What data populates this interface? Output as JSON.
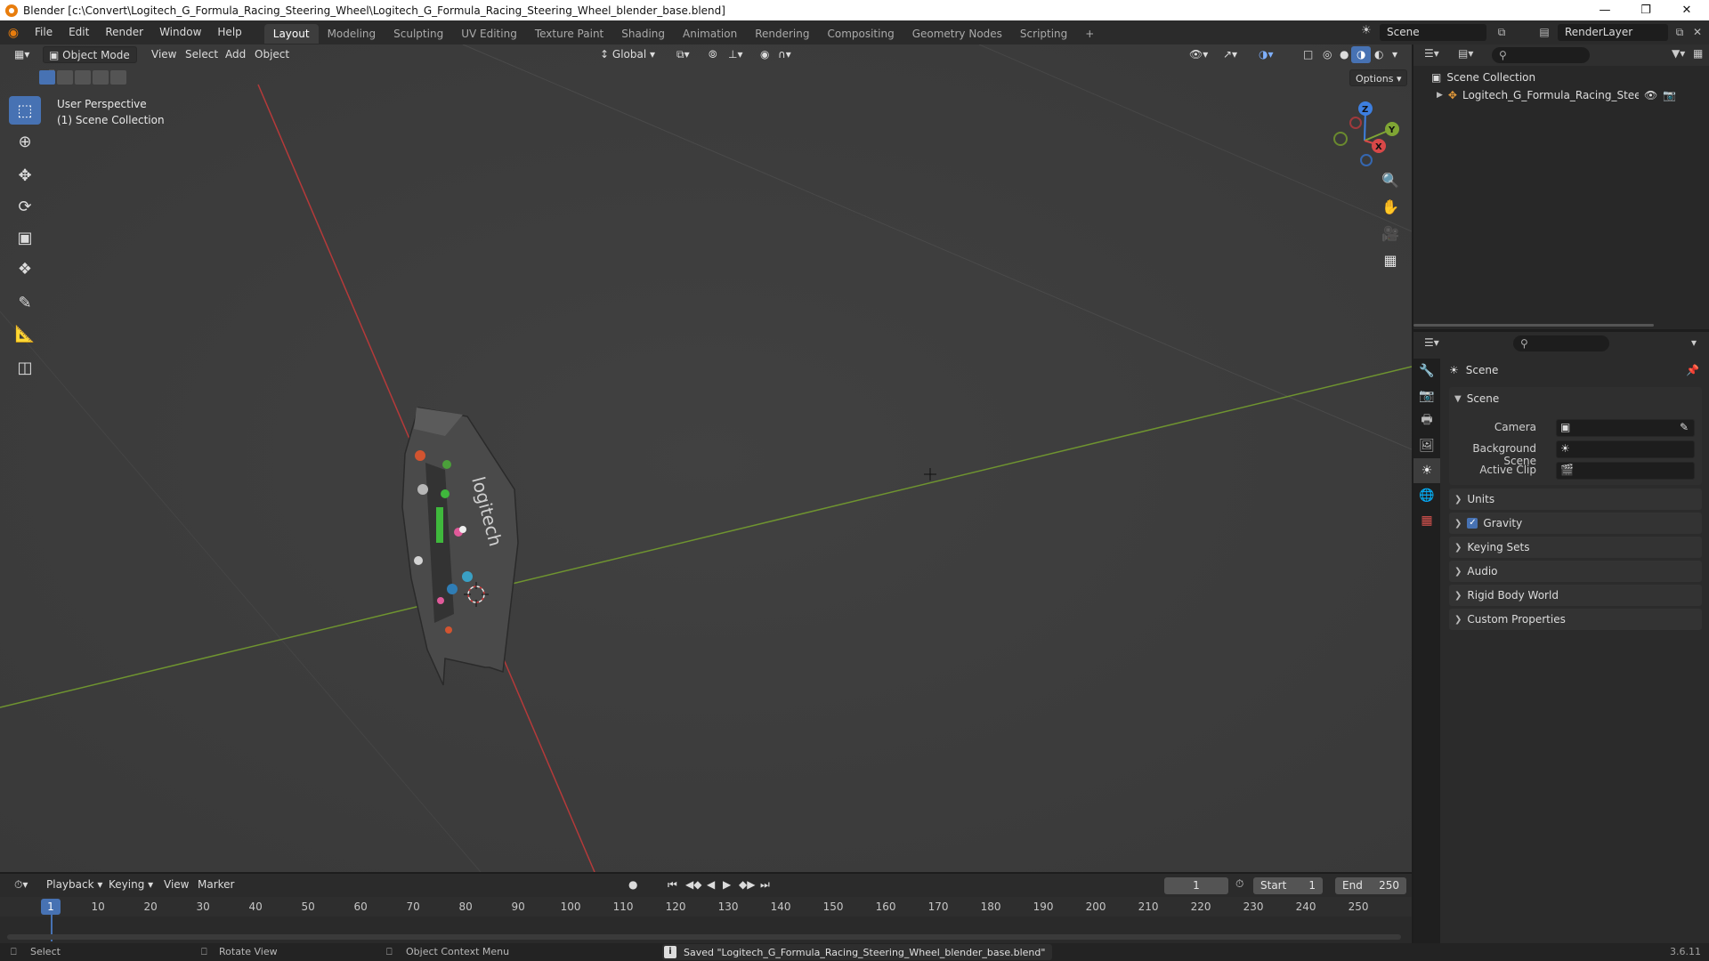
{
  "window": {
    "title": "Blender [c:\\Convert\\Logitech_G_Formula_Racing_Steering_Wheel\\Logitech_G_Formula_Racing_Steering_Wheel_blender_base.blend]"
  },
  "menubar": {
    "menus": [
      "File",
      "Edit",
      "Render",
      "Window",
      "Help"
    ],
    "workspaces": [
      "Layout",
      "Modeling",
      "Sculpting",
      "UV Editing",
      "Texture Paint",
      "Shading",
      "Animation",
      "Rendering",
      "Compositing",
      "Geometry Nodes",
      "Scripting"
    ],
    "active_workspace": "Layout",
    "scene": "Scene",
    "render_layer": "RenderLayer"
  },
  "viewport": {
    "mode": "Object Mode",
    "menus": [
      "View",
      "Select",
      "Add",
      "Object"
    ],
    "transform_orientation": "Global",
    "options_label": "Options",
    "overlay_line1": "User Perspective",
    "overlay_line2": "(1) Scene Collection",
    "gizmo_axes": [
      "Z",
      "Y",
      "X"
    ]
  },
  "outliner": {
    "root": "Scene Collection",
    "items": [
      "Logitech_G_Formula_Racing_Steering_V"
    ]
  },
  "properties": {
    "header": "Scene",
    "section_scene": "Scene",
    "fields": {
      "camera_label": "Camera",
      "background_scene_label": "Background Scene",
      "active_clip_label": "Active Clip"
    },
    "panels": [
      "Units",
      "Gravity",
      "Keying Sets",
      "Audio",
      "Rigid Body World",
      "Custom Properties"
    ],
    "gravity_checked": true
  },
  "timeline": {
    "menus": [
      "Playback",
      "Keying",
      "View",
      "Marker"
    ],
    "current_frame": "1",
    "start_label": "Start",
    "start_value": "1",
    "end_label": "End",
    "end_value": "250",
    "ticks": [
      "1",
      "10",
      "20",
      "30",
      "40",
      "50",
      "60",
      "70",
      "80",
      "90",
      "100",
      "110",
      "120",
      "130",
      "140",
      "150",
      "160",
      "170",
      "180",
      "190",
      "200",
      "210",
      "220",
      "230",
      "240",
      "250"
    ]
  },
  "statusbar": {
    "select": "Select",
    "rotate": "Rotate View",
    "context_menu": "Object Context Menu",
    "message": "Saved \"Logitech_G_Formula_Racing_Steering_Wheel_blender_base.blend\"",
    "version": "3.6.11"
  },
  "colors": {
    "accent": "#4772b3",
    "x_axis": "#d84848",
    "y_axis": "#7fa534",
    "z_axis": "#3d7fe0"
  }
}
